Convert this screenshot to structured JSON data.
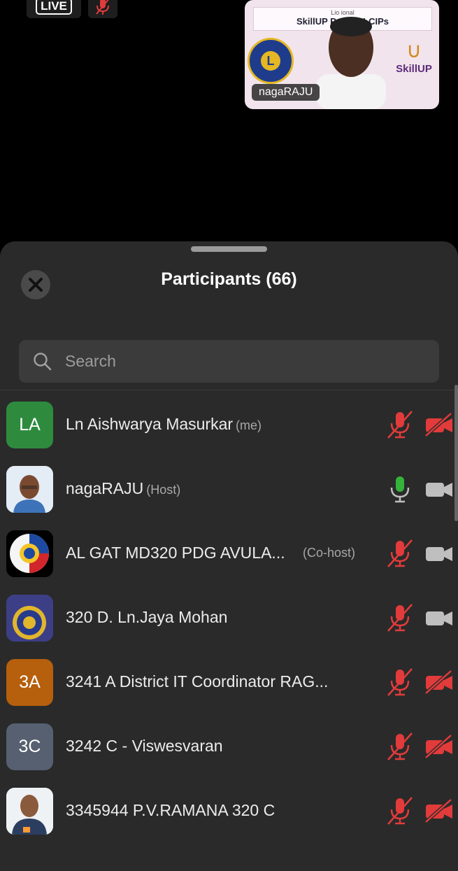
{
  "stream": {
    "live_label": "LIVE"
  },
  "video_tile": {
    "banner_line1": "Lio             ional",
    "banner_line2": "SkillUP Pr              s by LCIPs",
    "lions_badge": "L",
    "brand": "SkillUP",
    "speaker_name": "nagaRAJU"
  },
  "panel": {
    "title": "Participants (66)",
    "search_placeholder": "Search"
  },
  "participants": [
    {
      "initials": "LA",
      "avatar_color": "#2e8b3e",
      "name": "Ln Aishwarya Masurkar",
      "role": "(me)",
      "mic": "muted",
      "camera": "off"
    },
    {
      "initials": "",
      "avatar_color": "",
      "name": "nagaRAJU",
      "role": "(Host)",
      "mic": "active",
      "camera": "on"
    },
    {
      "initials": "",
      "avatar_color": "",
      "name": "AL GAT MD320 PDG AVULA...",
      "role": "(Co-host)",
      "mic": "muted",
      "camera": "on"
    },
    {
      "initials": "",
      "avatar_color": "",
      "name": "320 D. Ln.Jaya Mohan",
      "role": "",
      "mic": "muted",
      "camera": "on"
    },
    {
      "initials": "3A",
      "avatar_color": "#b65f0d",
      "name": "3241 A District IT Coordinator RAG...",
      "role": "",
      "mic": "muted",
      "camera": "off"
    },
    {
      "initials": "3C",
      "avatar_color": "#566070",
      "name": "3242 C - Viswesvaran",
      "role": "",
      "mic": "muted",
      "camera": "off"
    },
    {
      "initials": "",
      "avatar_color": "",
      "name": "3345944 P.V.RAMANA 320 C",
      "role": "",
      "mic": "muted",
      "camera": "off"
    }
  ],
  "colors": {
    "muted_red": "#e23b3b",
    "active_green": "#35b23a",
    "cam_gray": "#bfbfbf",
    "sheet_bg": "#2a2a2a"
  }
}
